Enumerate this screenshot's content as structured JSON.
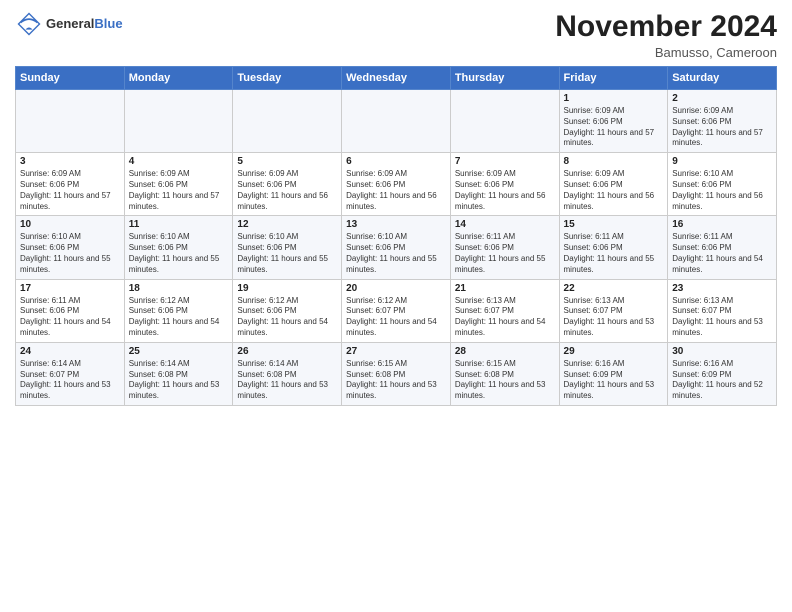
{
  "header": {
    "logo": {
      "general": "General",
      "blue": "Blue"
    },
    "title": "November 2024",
    "location": "Bamusso, Cameroon"
  },
  "weekdays": [
    "Sunday",
    "Monday",
    "Tuesday",
    "Wednesday",
    "Thursday",
    "Friday",
    "Saturday"
  ],
  "weeks": [
    [
      {
        "day": "",
        "info": ""
      },
      {
        "day": "",
        "info": ""
      },
      {
        "day": "",
        "info": ""
      },
      {
        "day": "",
        "info": ""
      },
      {
        "day": "",
        "info": ""
      },
      {
        "day": "1",
        "info": "Sunrise: 6:09 AM\nSunset: 6:06 PM\nDaylight: 11 hours and 57 minutes."
      },
      {
        "day": "2",
        "info": "Sunrise: 6:09 AM\nSunset: 6:06 PM\nDaylight: 11 hours and 57 minutes."
      }
    ],
    [
      {
        "day": "3",
        "info": "Sunrise: 6:09 AM\nSunset: 6:06 PM\nDaylight: 11 hours and 57 minutes."
      },
      {
        "day": "4",
        "info": "Sunrise: 6:09 AM\nSunset: 6:06 PM\nDaylight: 11 hours and 57 minutes."
      },
      {
        "day": "5",
        "info": "Sunrise: 6:09 AM\nSunset: 6:06 PM\nDaylight: 11 hours and 56 minutes."
      },
      {
        "day": "6",
        "info": "Sunrise: 6:09 AM\nSunset: 6:06 PM\nDaylight: 11 hours and 56 minutes."
      },
      {
        "day": "7",
        "info": "Sunrise: 6:09 AM\nSunset: 6:06 PM\nDaylight: 11 hours and 56 minutes."
      },
      {
        "day": "8",
        "info": "Sunrise: 6:09 AM\nSunset: 6:06 PM\nDaylight: 11 hours and 56 minutes."
      },
      {
        "day": "9",
        "info": "Sunrise: 6:10 AM\nSunset: 6:06 PM\nDaylight: 11 hours and 56 minutes."
      }
    ],
    [
      {
        "day": "10",
        "info": "Sunrise: 6:10 AM\nSunset: 6:06 PM\nDaylight: 11 hours and 55 minutes."
      },
      {
        "day": "11",
        "info": "Sunrise: 6:10 AM\nSunset: 6:06 PM\nDaylight: 11 hours and 55 minutes."
      },
      {
        "day": "12",
        "info": "Sunrise: 6:10 AM\nSunset: 6:06 PM\nDaylight: 11 hours and 55 minutes."
      },
      {
        "day": "13",
        "info": "Sunrise: 6:10 AM\nSunset: 6:06 PM\nDaylight: 11 hours and 55 minutes."
      },
      {
        "day": "14",
        "info": "Sunrise: 6:11 AM\nSunset: 6:06 PM\nDaylight: 11 hours and 55 minutes."
      },
      {
        "day": "15",
        "info": "Sunrise: 6:11 AM\nSunset: 6:06 PM\nDaylight: 11 hours and 55 minutes."
      },
      {
        "day": "16",
        "info": "Sunrise: 6:11 AM\nSunset: 6:06 PM\nDaylight: 11 hours and 54 minutes."
      }
    ],
    [
      {
        "day": "17",
        "info": "Sunrise: 6:11 AM\nSunset: 6:06 PM\nDaylight: 11 hours and 54 minutes."
      },
      {
        "day": "18",
        "info": "Sunrise: 6:12 AM\nSunset: 6:06 PM\nDaylight: 11 hours and 54 minutes."
      },
      {
        "day": "19",
        "info": "Sunrise: 6:12 AM\nSunset: 6:06 PM\nDaylight: 11 hours and 54 minutes."
      },
      {
        "day": "20",
        "info": "Sunrise: 6:12 AM\nSunset: 6:07 PM\nDaylight: 11 hours and 54 minutes."
      },
      {
        "day": "21",
        "info": "Sunrise: 6:13 AM\nSunset: 6:07 PM\nDaylight: 11 hours and 54 minutes."
      },
      {
        "day": "22",
        "info": "Sunrise: 6:13 AM\nSunset: 6:07 PM\nDaylight: 11 hours and 53 minutes."
      },
      {
        "day": "23",
        "info": "Sunrise: 6:13 AM\nSunset: 6:07 PM\nDaylight: 11 hours and 53 minutes."
      }
    ],
    [
      {
        "day": "24",
        "info": "Sunrise: 6:14 AM\nSunset: 6:07 PM\nDaylight: 11 hours and 53 minutes."
      },
      {
        "day": "25",
        "info": "Sunrise: 6:14 AM\nSunset: 6:08 PM\nDaylight: 11 hours and 53 minutes."
      },
      {
        "day": "26",
        "info": "Sunrise: 6:14 AM\nSunset: 6:08 PM\nDaylight: 11 hours and 53 minutes."
      },
      {
        "day": "27",
        "info": "Sunrise: 6:15 AM\nSunset: 6:08 PM\nDaylight: 11 hours and 53 minutes."
      },
      {
        "day": "28",
        "info": "Sunrise: 6:15 AM\nSunset: 6:08 PM\nDaylight: 11 hours and 53 minutes."
      },
      {
        "day": "29",
        "info": "Sunrise: 6:16 AM\nSunset: 6:09 PM\nDaylight: 11 hours and 53 minutes."
      },
      {
        "day": "30",
        "info": "Sunrise: 6:16 AM\nSunset: 6:09 PM\nDaylight: 11 hours and 52 minutes."
      }
    ]
  ]
}
